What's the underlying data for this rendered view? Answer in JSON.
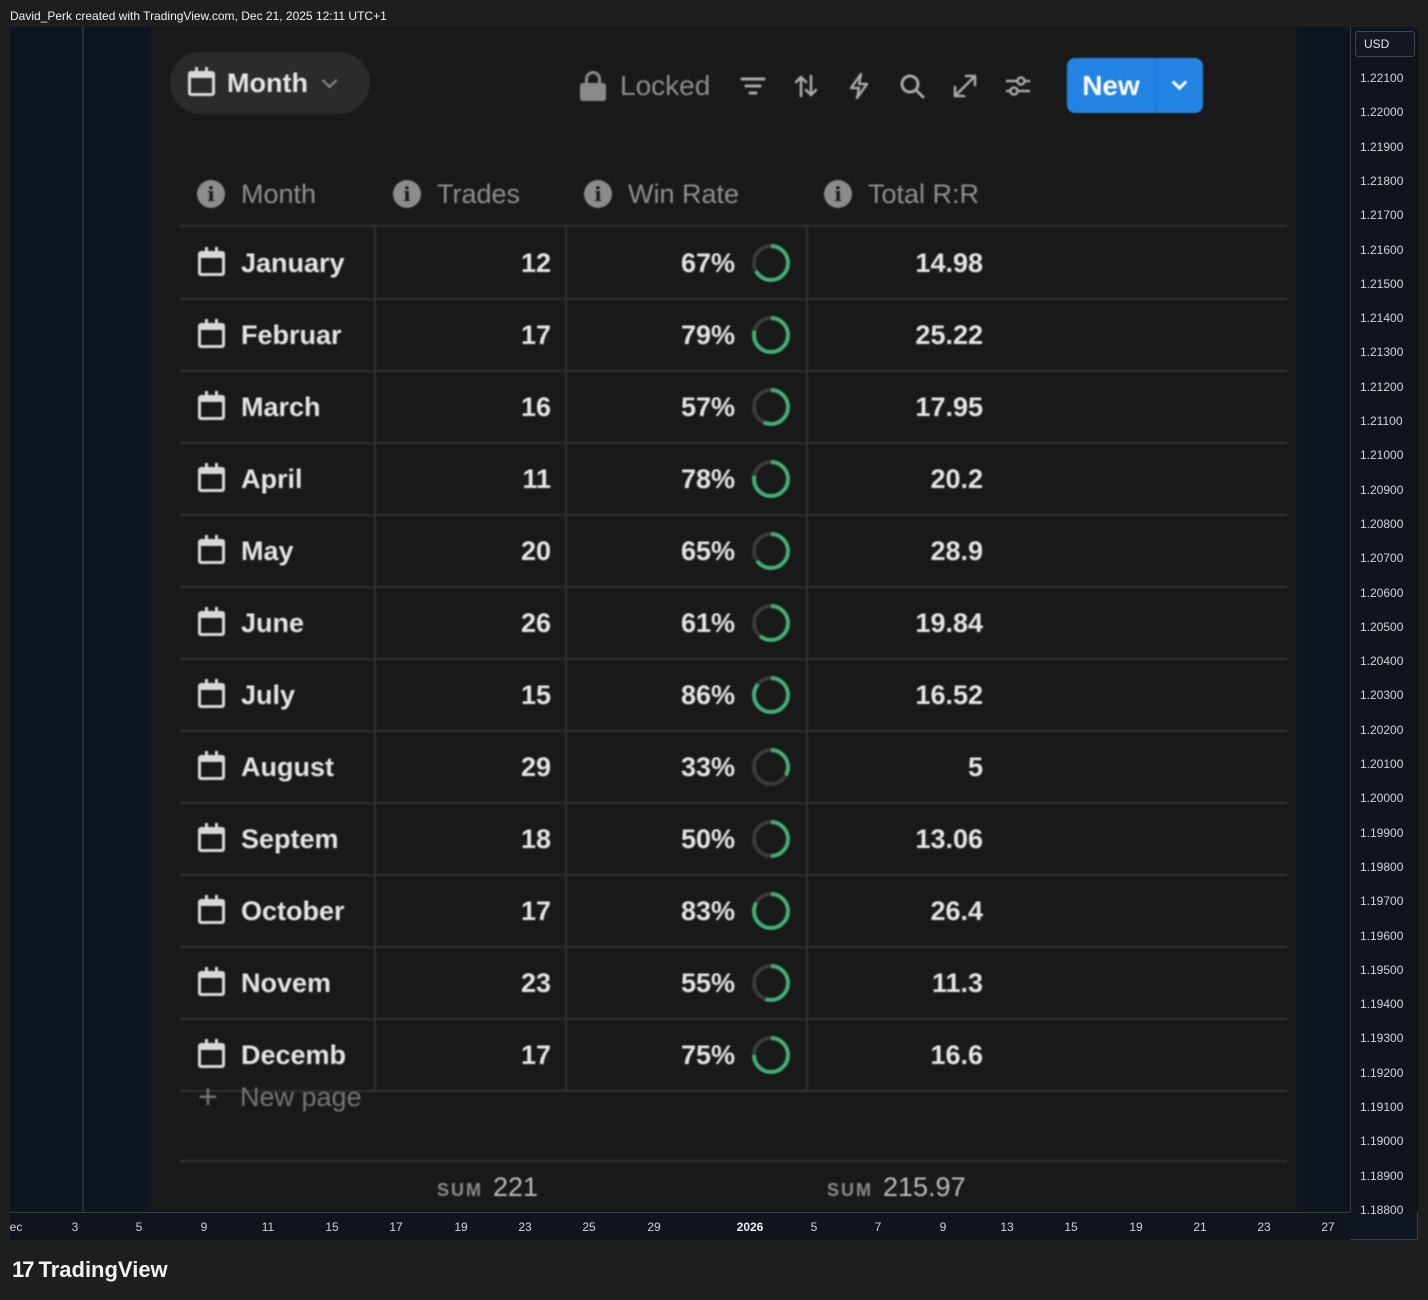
{
  "header": {
    "attribution": "David_Perk created with TradingView.com, Dec 21, 2025 12:11 UTC+1"
  },
  "toolbar": {
    "view_label": "Month",
    "locked_label": "Locked",
    "new_label": "New",
    "icons": [
      "filter-icon",
      "sort-icon",
      "lightning-icon",
      "search-icon",
      "expand-icon",
      "settings-sliders-icon"
    ]
  },
  "table": {
    "columns": [
      "Month",
      "Trades",
      "Win Rate",
      "Total R:R"
    ],
    "rows": [
      {
        "month": "January",
        "trades": "12",
        "win_rate": "67%",
        "win_fraction": 0.67,
        "rr": "14.98"
      },
      {
        "month": "Februar",
        "trades": "17",
        "win_rate": "79%",
        "win_fraction": 0.79,
        "rr": "25.22"
      },
      {
        "month": "March",
        "trades": "16",
        "win_rate": "57%",
        "win_fraction": 0.57,
        "rr": "17.95"
      },
      {
        "month": "April",
        "trades": "11",
        "win_rate": "78%",
        "win_fraction": 0.78,
        "rr": "20.2"
      },
      {
        "month": "May",
        "trades": "20",
        "win_rate": "65%",
        "win_fraction": 0.65,
        "rr": "28.9"
      },
      {
        "month": "June",
        "trades": "26",
        "win_rate": "61%",
        "win_fraction": 0.61,
        "rr": "19.84"
      },
      {
        "month": "July",
        "trades": "15",
        "win_rate": "86%",
        "win_fraction": 0.86,
        "rr": "16.52"
      },
      {
        "month": "August",
        "trades": "29",
        "win_rate": "33%",
        "win_fraction": 0.33,
        "rr": "5"
      },
      {
        "month": "Septem",
        "trades": "18",
        "win_rate": "50%",
        "win_fraction": 0.5,
        "rr": "13.06"
      },
      {
        "month": "October",
        "trades": "17",
        "win_rate": "83%",
        "win_fraction": 0.83,
        "rr": "26.4"
      },
      {
        "month": "Novem",
        "trades": "23",
        "win_rate": "55%",
        "win_fraction": 0.55,
        "rr": "11.3"
      },
      {
        "month": "Decemb",
        "trades": "17",
        "win_rate": "75%",
        "win_fraction": 0.75,
        "rr": "16.6"
      }
    ],
    "new_page_label": "New page",
    "sum_key": "SUM",
    "sum_trades": "221",
    "sum_rr": "215.97"
  },
  "price_axis": {
    "currency": "USD",
    "labels": [
      "1.22100",
      "1.22000",
      "1.21900",
      "1.21800",
      "1.21700",
      "1.21600",
      "1.21500",
      "1.21400",
      "1.21300",
      "1.21200",
      "1.21100",
      "1.21000",
      "1.20900",
      "1.20800",
      "1.20700",
      "1.20600",
      "1.20500",
      "1.20400",
      "1.20300",
      "1.20200",
      "1.20100",
      "1.20000",
      "1.19900",
      "1.19800",
      "1.19700",
      "1.19600",
      "1.19500",
      "1.19400",
      "1.19300",
      "1.19200",
      "1.19100",
      "1.19000",
      "1.18900",
      "1.18800"
    ]
  },
  "time_axis": {
    "labels": [
      "ec",
      "3",
      "5",
      "9",
      "11",
      "15",
      "17",
      "19",
      "23",
      "25",
      "29",
      "2026",
      "5",
      "7",
      "9",
      "13",
      "15",
      "19",
      "21",
      "23",
      "27"
    ]
  },
  "brand": {
    "name": "TradingView"
  },
  "colors": {
    "accent_blue": "#2383e2",
    "ring_green": "#3fae7a",
    "ring_track": "#3a3a3a"
  }
}
